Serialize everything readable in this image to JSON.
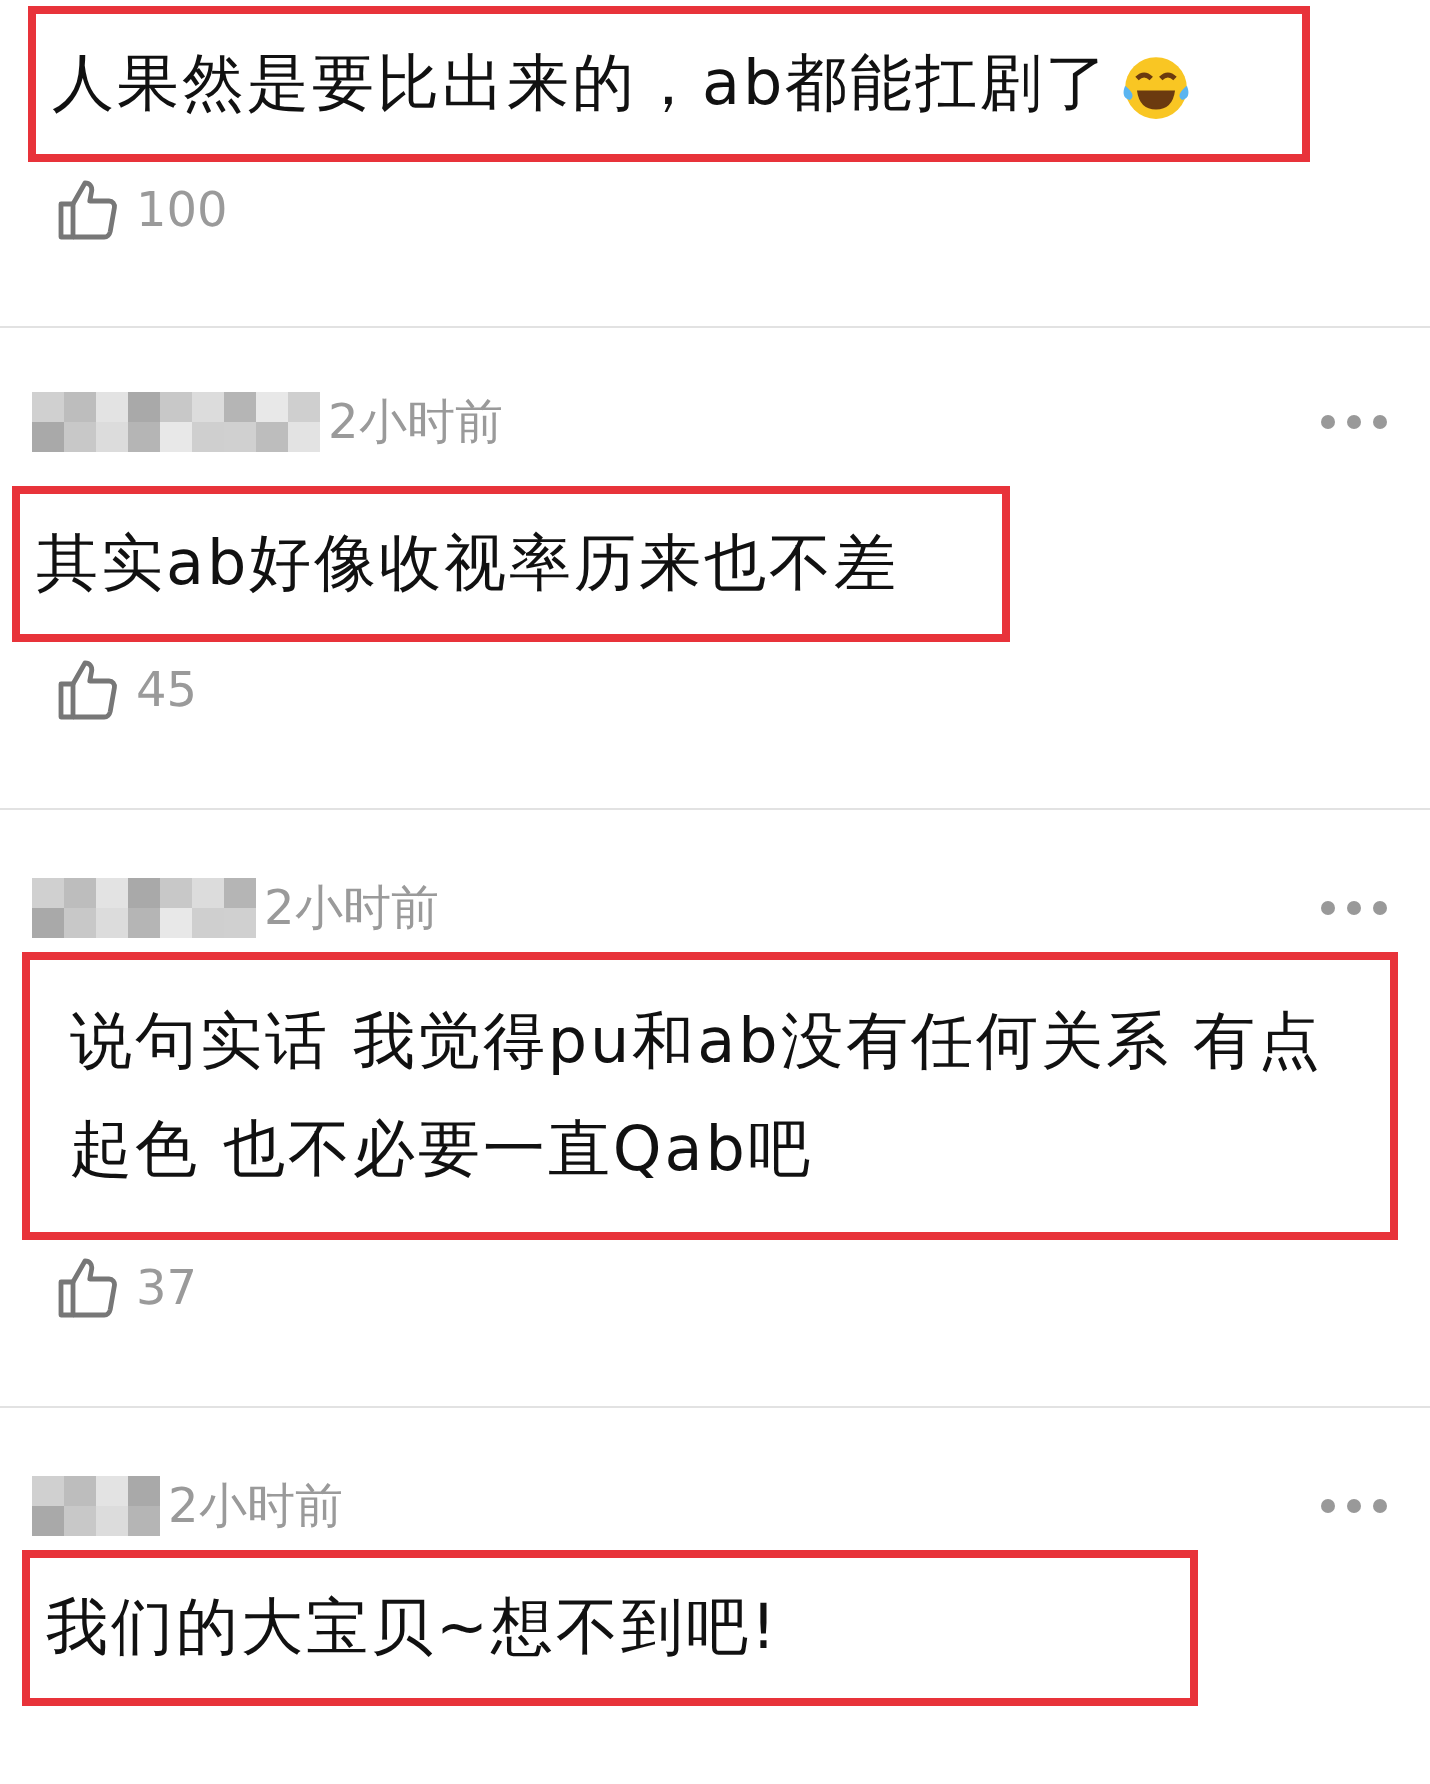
{
  "comments": [
    {
      "text": "人果然是要比出来的，ab都能扛剧了",
      "trailing_emoji": true,
      "likes": "100"
    },
    {
      "time": "2小时前",
      "text": "其实ab好像收视率历来也不差",
      "trailing_emoji": false,
      "likes": "45"
    },
    {
      "time": "2小时前",
      "text": "说句实话 我觉得pu和ab没有任何关系 有点起色 也不必要一直Qab吧",
      "trailing_emoji": false,
      "likes": "37"
    },
    {
      "time": "2小时前",
      "text": "我们的大宝贝~想不到吧!",
      "trailing_emoji": false
    }
  ]
}
